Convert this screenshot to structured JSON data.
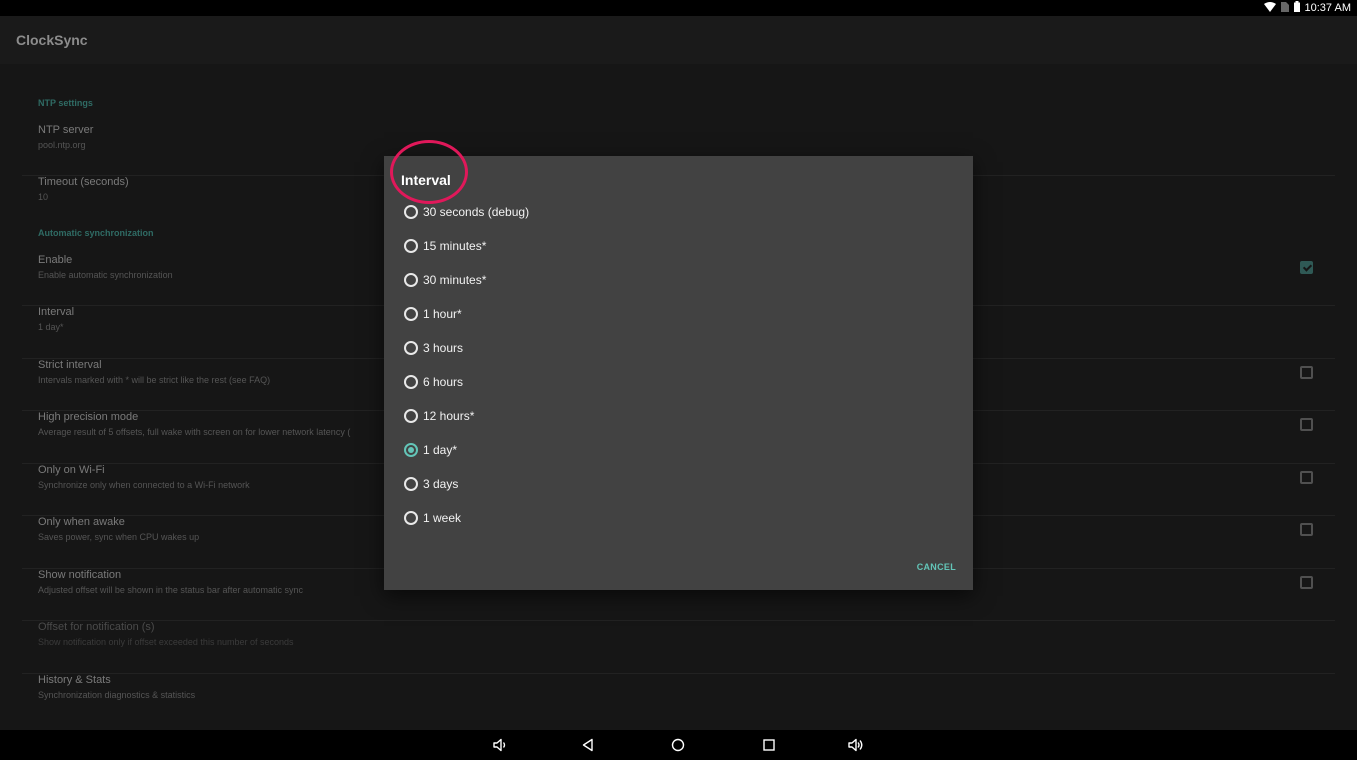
{
  "status_bar": {
    "time": "10:37 AM",
    "icons": [
      "wifi-icon",
      "sim-icon",
      "battery-icon"
    ]
  },
  "app": {
    "title": "ClockSync"
  },
  "preferences": {
    "categories": [
      "NTP settings",
      "Automatic synchronization"
    ],
    "items": [
      {
        "title": "NTP server",
        "summary": "pool.ntp.org"
      },
      {
        "title": "Timeout (seconds)",
        "summary": "10"
      },
      {
        "title": "Enable",
        "summary": "Enable automatic synchronization",
        "checked": true
      },
      {
        "title": "Interval",
        "summary": "1 day*"
      },
      {
        "title": "Strict interval",
        "summary": "Intervals marked with * will be strict like the rest (see FAQ)",
        "checked": false
      },
      {
        "title": "High precision mode",
        "summary": "Average result of 5 offsets, full wake with screen on for lower network latency (",
        "checked": false
      },
      {
        "title": "Only on Wi-Fi",
        "summary": "Synchronize only when connected to a Wi-Fi network",
        "checked": false
      },
      {
        "title": "Only when awake",
        "summary": "Saves power, sync when CPU wakes up",
        "checked": false
      },
      {
        "title": "Show notification",
        "summary": "Adjusted offset will be shown in the status bar after automatic sync",
        "checked": false
      },
      {
        "title": "Offset for notification (s)",
        "summary": "Show notification only if offset exceeded this number of seconds",
        "disabled": true
      },
      {
        "title": "History & Stats",
        "summary": "Synchronization diagnostics & statistics"
      }
    ]
  },
  "dialog": {
    "title": "Interval",
    "options": [
      {
        "label": "30 seconds (debug)",
        "selected": false
      },
      {
        "label": "15 minutes*",
        "selected": false
      },
      {
        "label": "30 minutes*",
        "selected": false
      },
      {
        "label": "1 hour*",
        "selected": false
      },
      {
        "label": "3 hours",
        "selected": false
      },
      {
        "label": "6 hours",
        "selected": false
      },
      {
        "label": "12 hours*",
        "selected": false
      },
      {
        "label": "1 day*",
        "selected": true
      },
      {
        "label": "3 days",
        "selected": false
      },
      {
        "label": "1 week",
        "selected": false
      }
    ],
    "cancel_label": "CANCEL"
  },
  "nav_bar": {
    "buttons": [
      "volume-down-icon",
      "back-icon",
      "home-icon",
      "recents-icon",
      "volume-up-icon"
    ]
  },
  "colors": {
    "accent": "#63c5b8",
    "highlight_ring": "#e0185a",
    "dialog_bg": "#424242"
  }
}
